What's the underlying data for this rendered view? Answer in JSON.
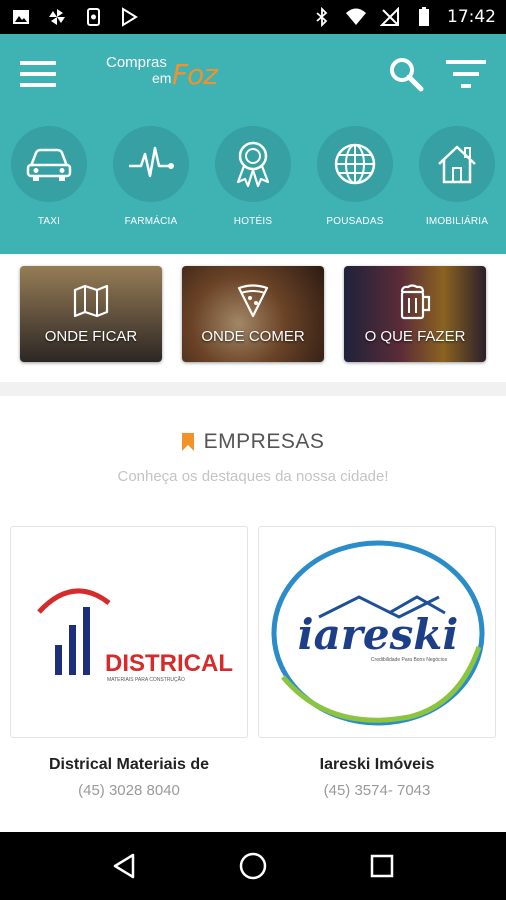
{
  "status_bar": {
    "time": "17:42",
    "left_icons": [
      "image-icon",
      "pinwheel-icon",
      "phone-vibrate-icon",
      "play-store-icon"
    ],
    "right_icons": [
      "bluetooth-icon",
      "wifi-icon",
      "no-sim-icon",
      "battery-icon"
    ]
  },
  "header": {
    "logo": {
      "line1": "Compras",
      "line2": "em",
      "brand": "Foz"
    },
    "colors": {
      "primary": "#3fb2b4",
      "circle": "#36a0a3",
      "accent": "#f39229"
    },
    "categories": [
      {
        "label": "TAXI",
        "icon": "car-icon"
      },
      {
        "label": "FARMÁCIA",
        "icon": "heartbeat-icon"
      },
      {
        "label": "HOTÉIS",
        "icon": "award-ribbon-icon"
      },
      {
        "label": "POUSADAS",
        "icon": "globe-icon"
      },
      {
        "label": "IMOBILIÁRIA",
        "icon": "house-icon"
      }
    ]
  },
  "quick_cards": [
    {
      "label": "ONDE FICAR",
      "icon": "map-icon"
    },
    {
      "label": "ONDE COMER",
      "icon": "pizza-slice-icon"
    },
    {
      "label": "O QUE FAZER",
      "icon": "beer-mug-icon"
    }
  ],
  "empresas": {
    "title": "EMPRESAS",
    "subtitle": "Conheça os destaques da nossa cidade!",
    "companies": [
      {
        "name": "Districal Materiais de",
        "phone": "(45) 3028 8040",
        "logo_text": "DISTRICAL",
        "logo_sub": "MATERIAIS PARA CONSTRUÇÃO"
      },
      {
        "name": "Iareski Imóveis",
        "phone": "(45) 3574- 7043",
        "logo_text": "iareski",
        "logo_sub": "Credibilidade Para Bons Negócios"
      }
    ]
  },
  "nav": {
    "icons": [
      "back-icon",
      "home-icon",
      "recents-icon"
    ]
  }
}
